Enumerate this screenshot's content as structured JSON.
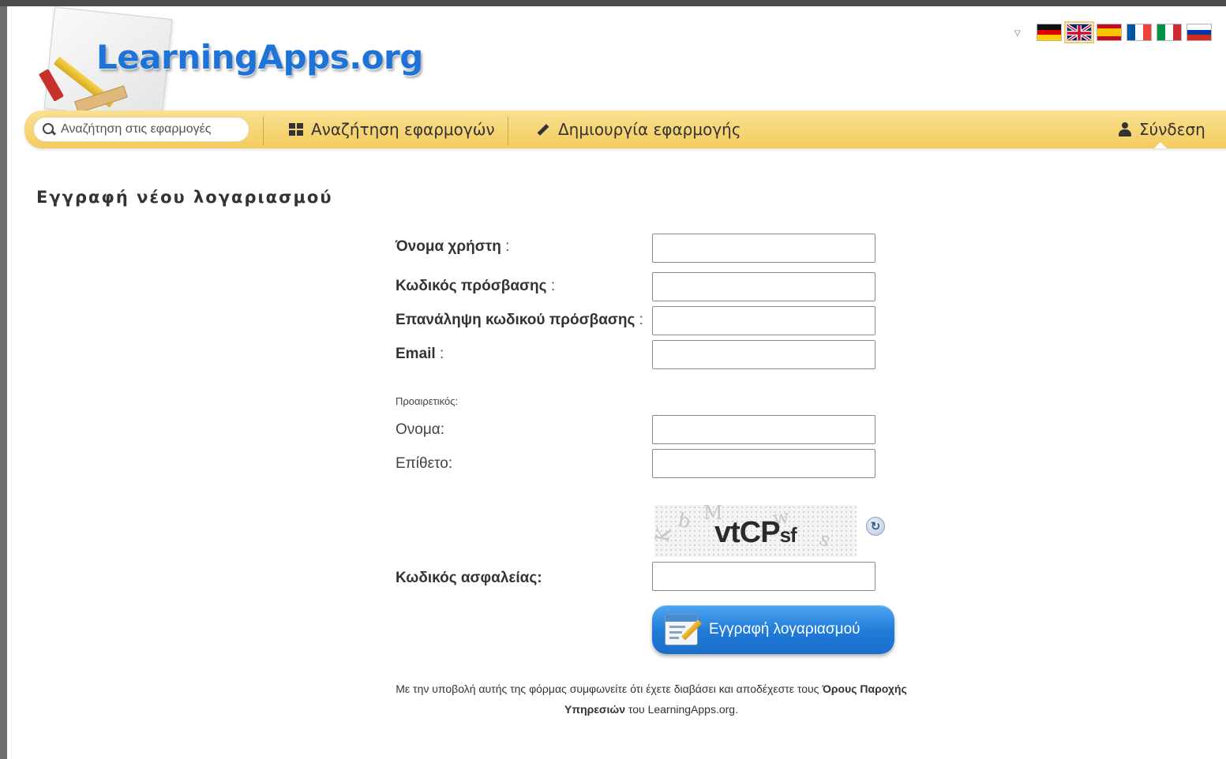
{
  "site": {
    "logo_text": "LearningApps.org"
  },
  "languages": {
    "dropdown_icon": "triangle-down-icon",
    "flags": [
      {
        "code": "de",
        "colors": [
          "#111111",
          "#dd0000",
          "#ffcc00"
        ],
        "orientation": "horizontal"
      },
      {
        "code": "en",
        "colors": [
          "#012169",
          "#ffffff",
          "#c8102e"
        ],
        "orientation": "uk",
        "selected": true
      },
      {
        "code": "es",
        "colors": [
          "#c60b1e",
          "#ffc400",
          "#c60b1e"
        ],
        "orientation": "horizontal"
      },
      {
        "code": "fr",
        "colors": [
          "#0055a4",
          "#ffffff",
          "#ef4135"
        ],
        "orientation": "vertical"
      },
      {
        "code": "it",
        "colors": [
          "#009246",
          "#ffffff",
          "#ce2b37"
        ],
        "orientation": "vertical"
      },
      {
        "code": "ru",
        "colors": [
          "#ffffff",
          "#0039a6",
          "#d52b1e"
        ],
        "orientation": "horizontal"
      }
    ]
  },
  "nav": {
    "search_placeholder": "Αναζήτηση στις εφαρμογές",
    "browse_label": "Αναζήτηση εφαρμογών",
    "create_label": "Δημιουργία εφαρμογής",
    "login_label": "Σύνδεση",
    "bar_color": "#f6d36e"
  },
  "page": {
    "title": "Εγγραφή νέου λογαριασμού"
  },
  "form": {
    "username_label": "Όνομα χρήστη",
    "password_label": "Κωδικός πρόσβασης",
    "password_repeat_label": "Επανάληψη κωδικού πρόσβασης",
    "email_label": "Email",
    "colon": ":",
    "optional_label": "Προαιρετικός:",
    "firstname_label": "Ονομα:",
    "lastname_label": "Επίθετο:",
    "captcha_text_main": "vtCP",
    "captcha_text_small": "sf",
    "security_code_label": "Κωδικός ασφαλείας:",
    "username_value": "",
    "password_value": "",
    "password_repeat_value": "",
    "email_value": "",
    "firstname_value": "",
    "lastname_value": "",
    "security_code_value": "",
    "submit_label": "Εγγραφή λογαριασμού",
    "submit_color": "#1f7ad7"
  },
  "terms": {
    "text_before": "Με την υποβολή αυτής της φόρμας συμφωνείτε ότι έχετε διαβάσει και αποδέχεστε τους ",
    "link_text": "Όρους Παροχής Υπηρεσιών",
    "text_after": " του LearningApps.org."
  }
}
